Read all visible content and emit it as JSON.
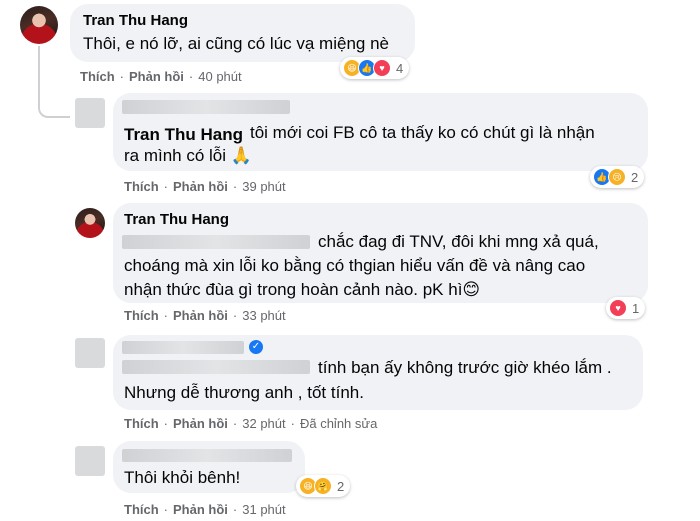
{
  "comments": [
    {
      "author": "Tran Thu Hang",
      "text": "Thôi, e nó lỡ, ai cũng có lúc vạ miệng nè",
      "like": "Thích",
      "reply": "Phản hồi",
      "time": "40 phút",
      "reaction_count": "4"
    },
    {
      "author": "Tran Thu Hang",
      "text_line1": "tôi mới coi FB cô ta thấy ko có chút gì là nhận",
      "text_line2": "ra mình có lỗi 🙏",
      "like": "Thích",
      "reply": "Phản hồi",
      "time": "39 phút",
      "reaction_count": "2"
    },
    {
      "author": "Tran Thu Hang",
      "text_line1": "chắc đag đi TNV, đôi khi mng xả quá,",
      "text_line2": "choáng mà xin lỗi ko bằng có thgian hiểu vấn đề và nâng cao",
      "text_line3": "nhận thức đùa gì trong hoàn cảnh nào. pK hì😊",
      "like": "Thích",
      "reply": "Phản hồi",
      "time": "33 phút",
      "reaction_count": "1"
    },
    {
      "text_line1": "tính bạn ấy không trước giờ khéo lắm .",
      "text_line2": "Nhưng dễ thương anh , tốt tính.",
      "like": "Thích",
      "reply": "Phản hồi",
      "time": "32 phút",
      "edited": "Đã chỉnh sửa"
    },
    {
      "text": "Thôi khỏi bênh!",
      "like": "Thích",
      "reply": "Phản hồi",
      "time": "31 phút",
      "reaction_count": "2"
    }
  ],
  "separator": "·"
}
